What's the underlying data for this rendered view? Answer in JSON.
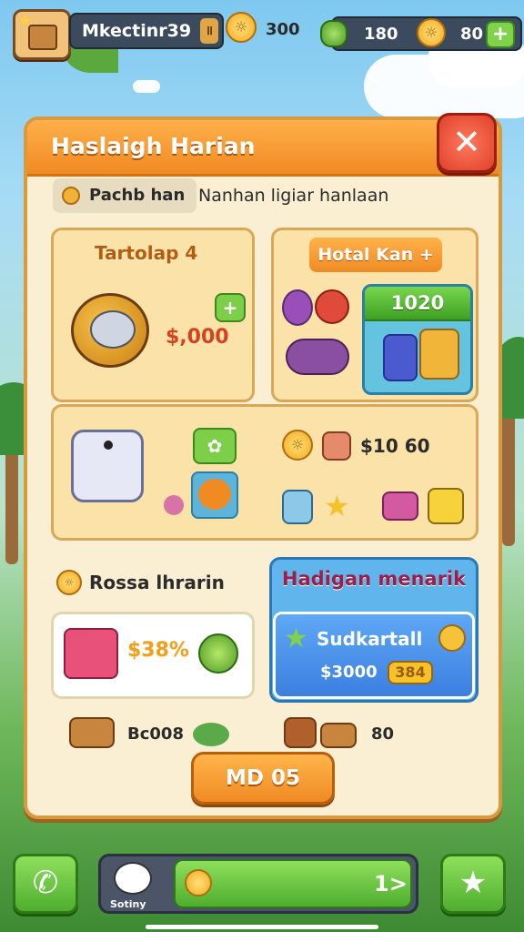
{
  "topbar": {
    "player_name": "Mkectinr39",
    "coins": "300",
    "gems": "180",
    "currency2": "80",
    "plus": "+"
  },
  "panel": {
    "title": "Haslaigh Harian",
    "close": "✕",
    "subtab_label": "Pachb han",
    "subtab_desc": "Nanhan ligiar hanlaan"
  },
  "cards": {
    "card1_title": "Tartolap 4",
    "card1_price": "$,000",
    "card2_title": "Hotal Kan +",
    "card2_offer_value": "1020",
    "middle_price": "$10 60",
    "rossa_label": "Rossa lhrarin",
    "white_price": "$38%",
    "blue_title": "Hadigan menarik",
    "blue_name": "Sudkartall",
    "blue_price": "$3000",
    "blue_tag": "384",
    "row_left": "Bc008",
    "row_right": "80"
  },
  "cta": {
    "label": "MD 05"
  },
  "bottom": {
    "pet_label": "Sotiny",
    "arrow": "1>"
  },
  "colors": {
    "accent": "#f08a23",
    "green": "#4fae2e",
    "panel": "#fbefd3"
  }
}
